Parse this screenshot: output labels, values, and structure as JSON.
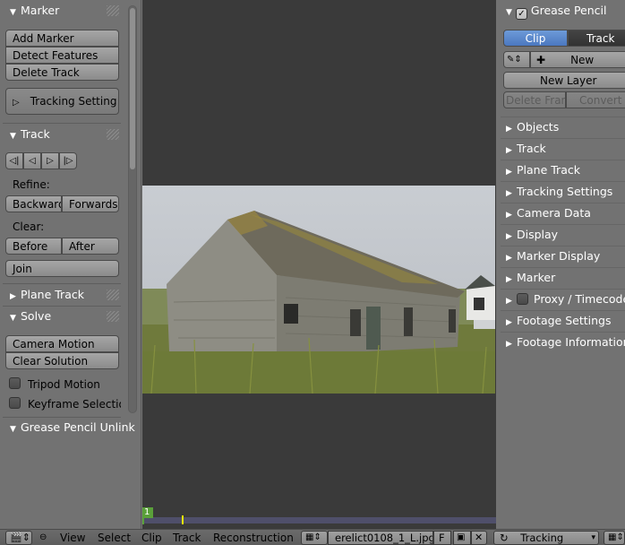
{
  "left_panel": {
    "marker": {
      "title": "Marker",
      "add_marker": "Add Marker",
      "detect_features": "Detect Features",
      "delete_track": "Delete Track",
      "tracking_settings": "Tracking Setting"
    },
    "track": {
      "title": "Track",
      "refine_label": "Refine:",
      "backward": "Backward",
      "forwards": "Forwards",
      "clear_label": "Clear:",
      "before": "Before",
      "after": "After",
      "join": "Join"
    },
    "plane_track": {
      "title": "Plane Track"
    },
    "solve": {
      "title": "Solve",
      "camera_motion": "Camera Motion",
      "clear_solution": "Clear Solution",
      "tripod_motion": "Tripod Motion",
      "keyframe_selection": "Keyframe Selectio"
    },
    "grease_pencil": {
      "title": "Grease Pencil Unlink"
    }
  },
  "timeline": {
    "frame": "1"
  },
  "right_panel": {
    "grease_pencil": {
      "title": "Grease Pencil",
      "clip_tab": "Clip",
      "track_tab": "Track",
      "new": "New",
      "new_layer": "New Layer",
      "delete_frame": "Delete Fram",
      "convert": "Convert"
    },
    "sections": [
      "Objects",
      "Track",
      "Plane Track",
      "Tracking Settings",
      "Camera Data",
      "Display",
      "Marker Display",
      "Marker",
      "Proxy / Timecode",
      "Footage Settings",
      "Footage Information"
    ]
  },
  "footer": {
    "menus": [
      "View",
      "Select",
      "Clip",
      "Track",
      "Reconstruction"
    ],
    "clip_name": "erelict0108_1_L.jpg",
    "fake_user": "F",
    "mode": "Tracking"
  },
  "colors": {
    "accent": "#5680c2",
    "frame_marker": "#5aa03a",
    "background": "#727272",
    "viewport": "#3a3a3a"
  }
}
